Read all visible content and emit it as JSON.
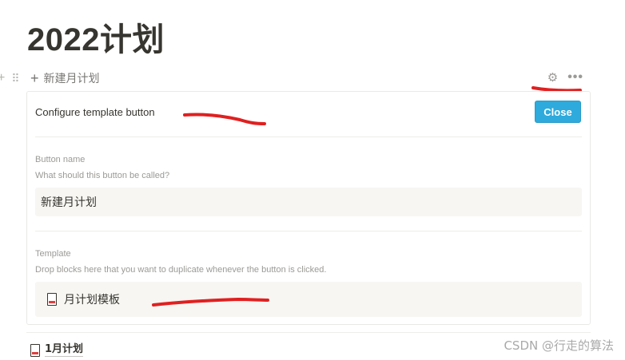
{
  "page": {
    "title": "2022计划"
  },
  "template_button": {
    "label": "新建月计划"
  },
  "config": {
    "header": "Configure template button",
    "close_label": "Close",
    "button_name": {
      "label": "Button name",
      "help": "What should this button be called?",
      "value": "新建月计划"
    },
    "template": {
      "label": "Template",
      "help": "Drop blocks here that you want to duplicate whenever the button is clicked.",
      "block_name": "月计划模板"
    }
  },
  "child_page": {
    "label": "1月计划"
  },
  "watermark": "CSDN @行走的算法",
  "colors": {
    "accent": "#2eaadc",
    "annotation": "#e02020",
    "text": "#37352f",
    "muted": "#9b9a97"
  },
  "icons": [
    "plus-icon",
    "drag-handle-icon",
    "gear-icon",
    "more-icon",
    "page-icon"
  ]
}
